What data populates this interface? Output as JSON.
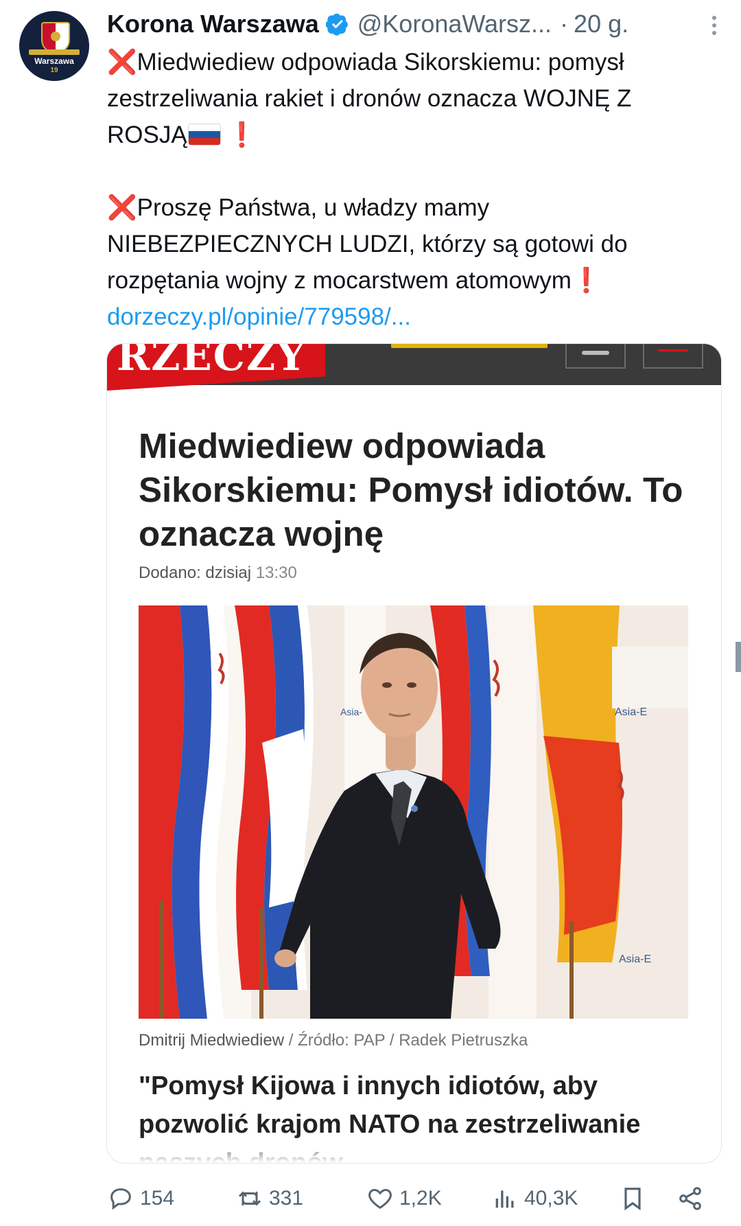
{
  "tweet": {
    "author_name": "Korona Warszawa",
    "handle": "@KoronaWarsz...",
    "separator": "·",
    "time": "20 g.",
    "avatar": {
      "city": "Warszawa",
      "number": "19"
    },
    "paragraph1": "Miedwiediew odpowiada Sikorskiemu: pomysł zestrzeliwania rakiet i dronów oznacza WOJNĘ Z ROSJĄ",
    "paragraph2": "Proszę Państwa, u władzy mamy NIEBEZPIECZNYCH LUDZI, którzy są gotowi do rozpętania wojny z mocarstwem atomowym",
    "link": "dorzeczy.pl/opinie/779598/...",
    "x_mark": "❌",
    "exclamation": "❗"
  },
  "card": {
    "logo_text": "RZECZY",
    "headline": "Miedwiediew odpowiada Sikorskiemu: Pomysł idiotów. To oznacza wojnę",
    "added_label": "Dodano: dzisiaj",
    "added_time": "13:30",
    "photo_caption": "Dmitrij Miedwiediew",
    "photo_source": " / Źródło: PAP / Radek Pietruszka",
    "flag_text_1": "Asia-",
    "flag_text_2": "Asia-E",
    "flag_text_3": "Asia-E",
    "quote": "\"Pomysł Kijowa i innych idiotów, aby pozwolić krajom NATO na zestrzeliwanie naszych dronów"
  },
  "actions": {
    "replies": "154",
    "retweets": "331",
    "likes": "1,2K",
    "views": "40,3K"
  },
  "colors": {
    "link": "#1d9bf0",
    "secondary_text": "#536471",
    "brand_red": "#d7141a",
    "verified": "#1d9bf0"
  }
}
